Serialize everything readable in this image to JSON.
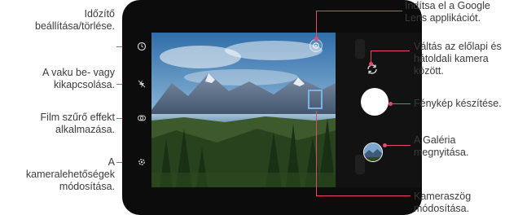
{
  "left_callouts": [
    {
      "lines": [
        "Időzítő",
        "beállítása/törlése."
      ]
    },
    {
      "lines": [
        "A vaku be- vagy",
        "kikapcsolása."
      ]
    },
    {
      "lines": [
        "Film szűrő effekt",
        "alkalmazása."
      ]
    },
    {
      "lines": [
        "A",
        "kameralehetőségek",
        "módosítása."
      ]
    }
  ],
  "right_callouts": [
    {
      "lines": [
        "Indítsa el a Google",
        "Lens applikációt."
      ]
    },
    {
      "lines": [
        "Váltás az előlapi és",
        "hátoldali kamera",
        "között."
      ]
    },
    {
      "lines": [
        "Fénykép készítése."
      ]
    },
    {
      "lines": [
        "A Galéria",
        "megnyitása."
      ]
    },
    {
      "lines": [
        "Kameraszög",
        "módosítása."
      ]
    }
  ],
  "icons": {
    "timer": "timer-icon",
    "flash": "flash-icon",
    "film_filter": "film-filter-icon",
    "camera_options": "camera-options-icon",
    "google_lens": "google-lens-icon",
    "switch_camera": "switch-camera-icon",
    "shutter": "shutter-icon",
    "gallery": "gallery-thumbnail",
    "camera_angle": "camera-angle-icon"
  },
  "colors": {
    "accent": "#e8476a",
    "zoom_frame": "#79b4e6",
    "text": "#3a3a3a"
  }
}
